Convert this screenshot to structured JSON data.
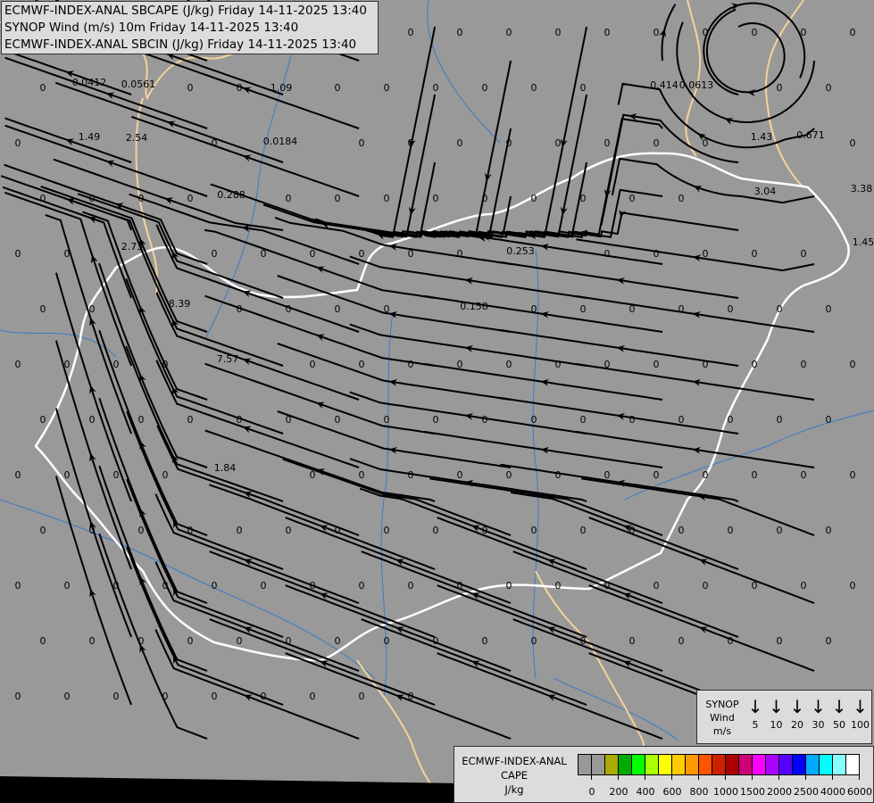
{
  "header": {
    "lines": [
      "ECMWF-INDEX-ANAL SBCAPE (J/kg) Friday 14-11-2025 13:40",
      "SYNOP Wind (m/s) 10m Friday 14-11-2025 13:40",
      "ECMWF-INDEX-ANAL SBCIN (J/kg) Friday 14-11-2025 13:40"
    ]
  },
  "map": {
    "background_color": "#999999",
    "streamline_color": "#000000",
    "national_border_color": "#ffffff",
    "other_border_color": "#f5d29a",
    "river_color": "#3a7ac8",
    "zero_label": "0",
    "cape_values": [
      "0.0412",
      "0.0561",
      "1.09",
      "1.49",
      "2.54",
      "0.0184",
      "0.288",
      "0.414",
      "0.0613",
      "1.43",
      "0.671",
      "3.38",
      "3.04",
      "1.45",
      "2.73",
      "0.253",
      "8.39",
      "0.158",
      "7.57",
      "1.84"
    ]
  },
  "synop_legend": {
    "title_lines": [
      "SYNOP",
      "Wind",
      "m/s"
    ],
    "icon": "wind-arrow-down-icon",
    "speeds": [
      "5",
      "10",
      "20",
      "30",
      "50",
      "100"
    ]
  },
  "cape_legend": {
    "title_lines": [
      "ECMWF-INDEX-ANAL",
      "CAPE",
      "J/kg"
    ],
    "colors": [
      "#999999",
      "#999999",
      "#aaaa00",
      "#00aa00",
      "#00ff00",
      "#aaff00",
      "#ffff00",
      "#ffcc00",
      "#ff9900",
      "#ff5500",
      "#cc2200",
      "#aa0000",
      "#cc0077",
      "#ff00ff",
      "#aa00ff",
      "#5500ff",
      "#0000ff",
      "#00aaff",
      "#00ffff",
      "#88ffff",
      "#ffffff"
    ],
    "tick_labels": [
      "0",
      "200",
      "400",
      "600",
      "800",
      "1000",
      "1500",
      "2000",
      "2500",
      "4000",
      "6000"
    ]
  }
}
